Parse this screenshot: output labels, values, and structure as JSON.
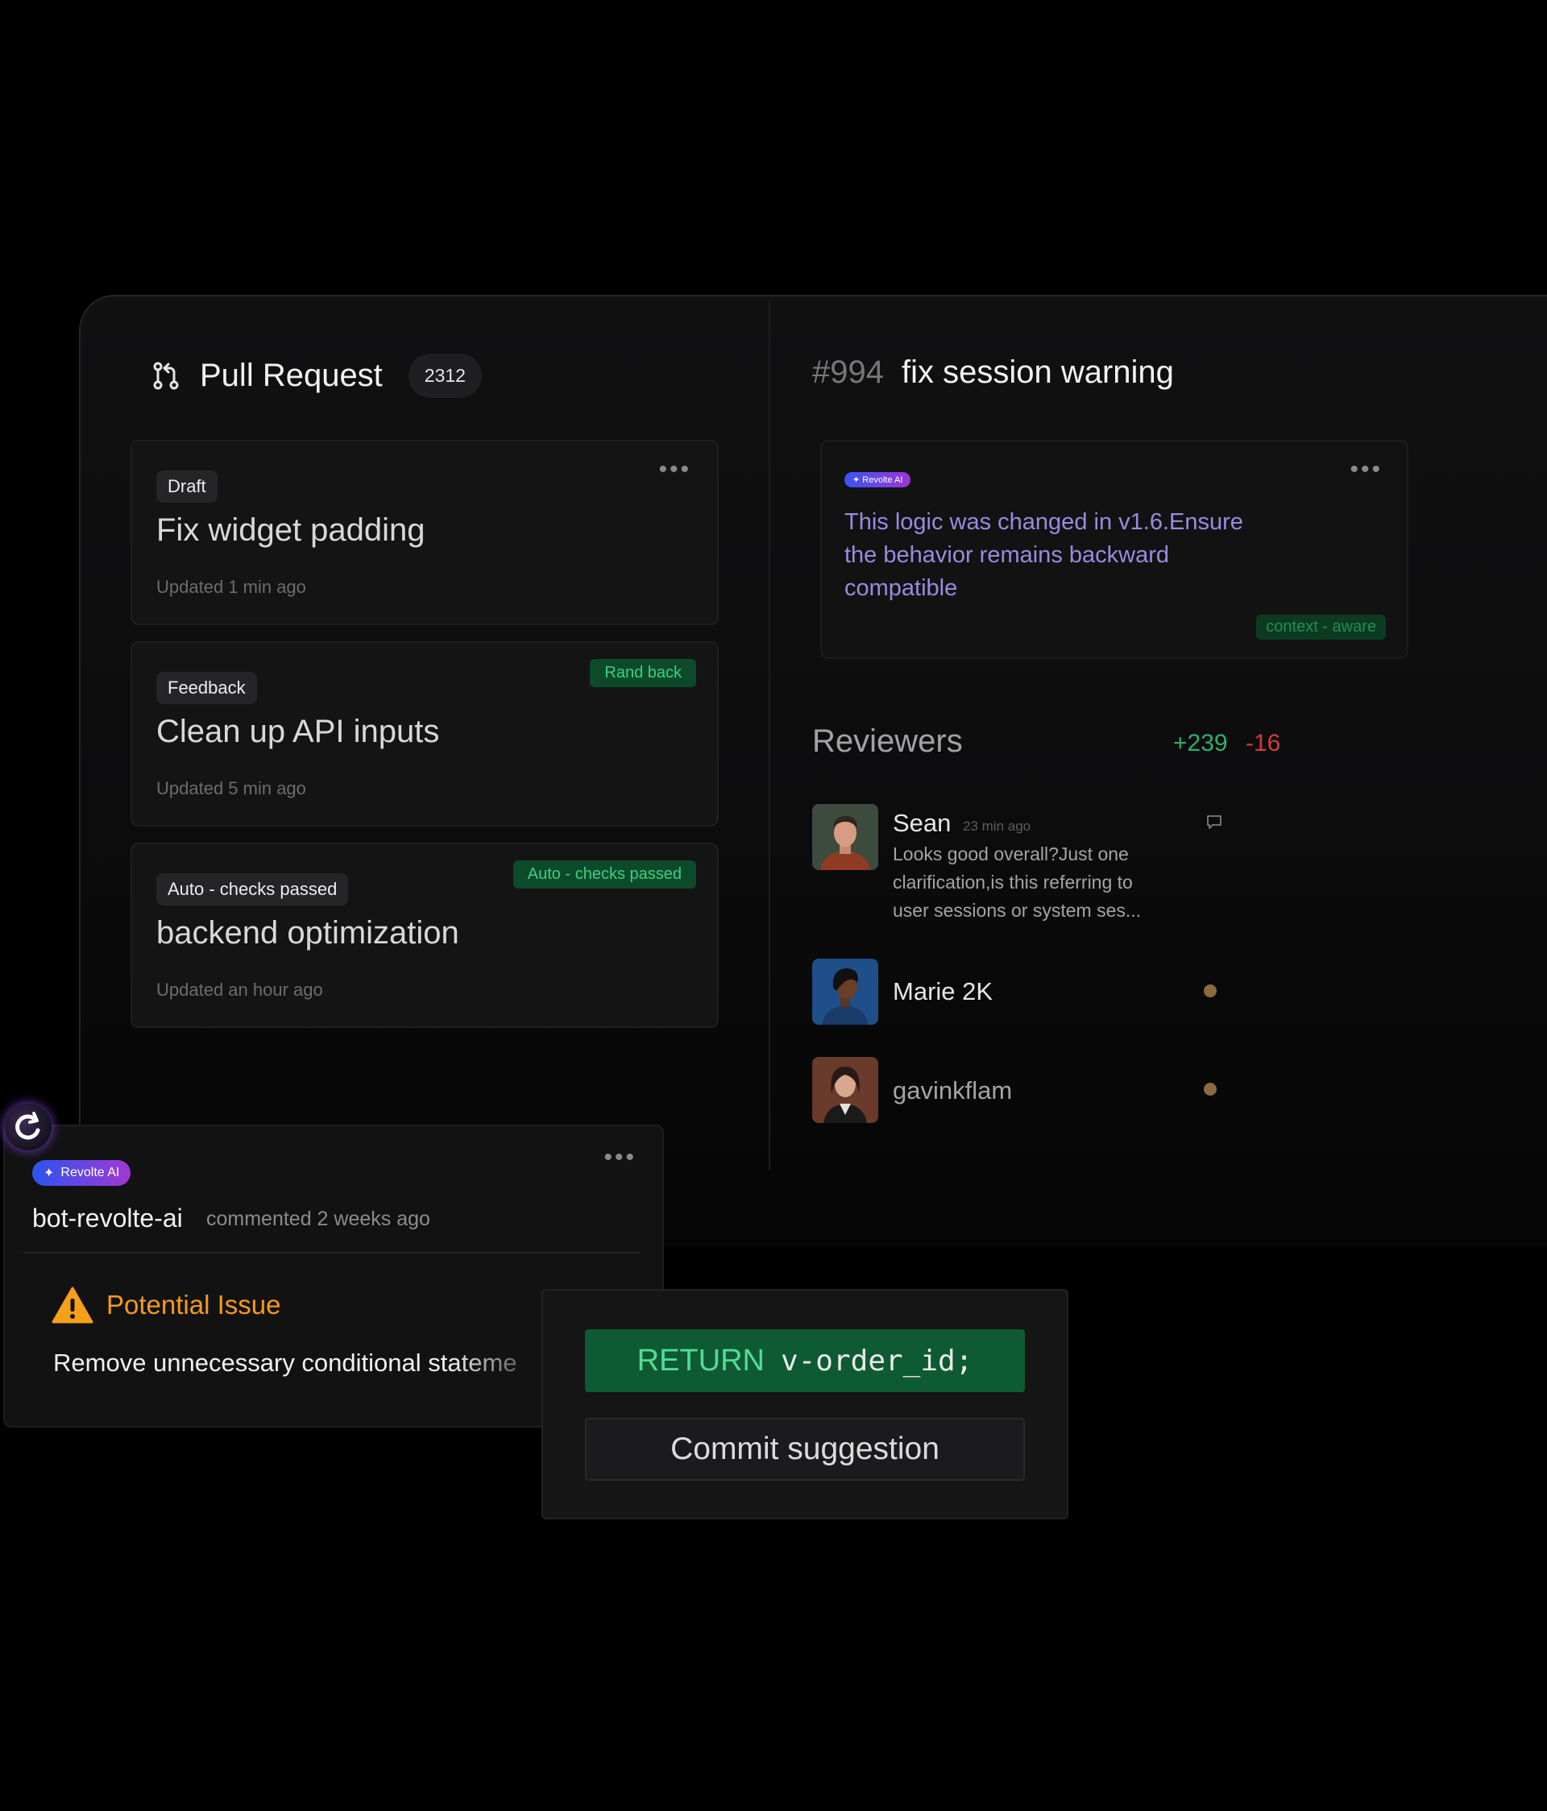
{
  "pull_requests": {
    "title": "Pull Request",
    "count": "2312",
    "items": [
      {
        "tag": "Draft",
        "title": "Fix widget padding",
        "updated": "Updated 1 min ago",
        "status": ""
      },
      {
        "tag": "Feedback",
        "title": "Clean up API inputs",
        "updated": "Updated 5 min ago",
        "status": "Rand back"
      },
      {
        "tag": "Auto - checks passed",
        "title": "backend optimization",
        "updated": "Updated an hour ago",
        "status": "Auto - checks passed"
      }
    ]
  },
  "detail": {
    "number": "#994",
    "title": "fix session warning",
    "ai_badge": "Revolte AI",
    "ai_comment": "This logic was changed in v1.6.Ensure the behavior remains backward compatible",
    "context_badge": "context - aware"
  },
  "reviewers": {
    "title": "Reviewers",
    "additions": "+239",
    "deletions": "-16",
    "items": [
      {
        "name": "Sean",
        "time": "23 min ago",
        "comment": "Looks good overall?Just one clarification,is this referring to user sessions or system ses..."
      },
      {
        "name": "Marie 2K"
      },
      {
        "name": "gavinkflam"
      }
    ]
  },
  "bot_comment": {
    "badge": "Revolte AI",
    "author": "bot-revolte-ai",
    "meta": "commented 2 weeks ago",
    "issue_label": "Potential Issue",
    "issue_text": "Remove unnecessary conditional stateme"
  },
  "suggestion": {
    "keyword": "RETURN",
    "value": "v-order_id;",
    "button": "Commit suggestion"
  },
  "colors": {
    "background": "#000000",
    "ai_text": "#9b8ae0",
    "success": "#3ad17f",
    "danger": "#d43a3a",
    "warning": "#f59a1b"
  },
  "icons": [
    "pull-request-icon",
    "more-icon",
    "sparkle-icon",
    "comment-icon",
    "revolte-logo-icon",
    "warning-icon"
  ]
}
